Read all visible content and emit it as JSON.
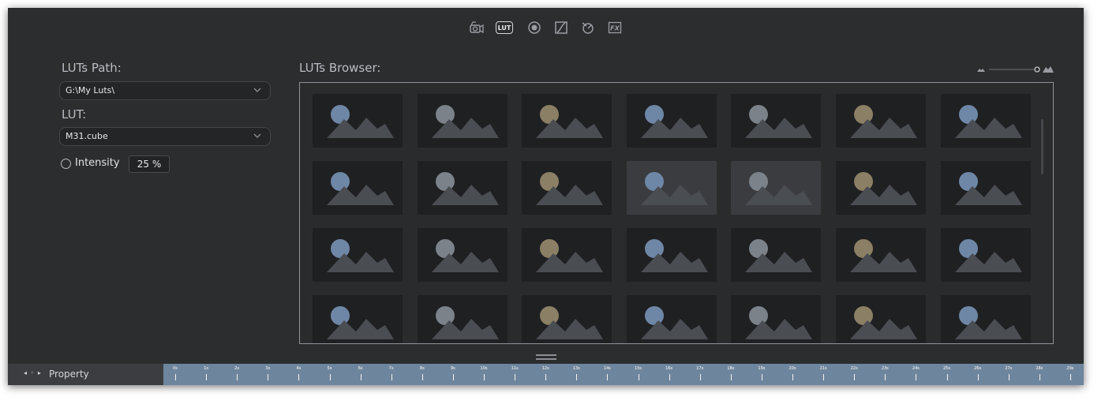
{
  "toolbar": {
    "items": [
      {
        "name": "camera-icon",
        "label": ""
      },
      {
        "name": "lut-icon",
        "label": "LUT"
      },
      {
        "name": "lens-icon",
        "label": ""
      },
      {
        "name": "curve-icon",
        "label": ""
      },
      {
        "name": "rotate-icon",
        "label": ""
      },
      {
        "name": "fx-icon",
        "label": "FX"
      }
    ],
    "selected": "LUT"
  },
  "left_panel": {
    "luts_path_label": "LUTs Path:",
    "luts_path_value": "G:\\My Luts\\",
    "lut_label": "LUT:",
    "lut_value": "M31.cube",
    "intensity_label": "Intensity",
    "intensity_value": "25 %"
  },
  "browser": {
    "label": "LUTs Browser:",
    "rows": 4,
    "cols": 7,
    "selected_index": 10
  },
  "timeline": {
    "nav_glyph": "◂ ◦ ▸",
    "property_label": "Property",
    "ticks": [
      "0s",
      "1s",
      "2s",
      "3s",
      "4s",
      "5s",
      "6s",
      "7s",
      "8s",
      "9s",
      "10s",
      "11s",
      "12s",
      "13s",
      "14s",
      "15s",
      "16s",
      "17s",
      "18s",
      "19s",
      "20s",
      "21s",
      "22s",
      "23s",
      "24s",
      "25s",
      "26s",
      "27s",
      "28s",
      "29s"
    ]
  },
  "colors": {
    "background": "#2c2d2f",
    "timeline": "#6e869d",
    "sun_blue": "#6f87a6",
    "sun_tan": "#8b7f65",
    "sun_gray": "#7b8289",
    "mountain": "#4a4d52"
  }
}
